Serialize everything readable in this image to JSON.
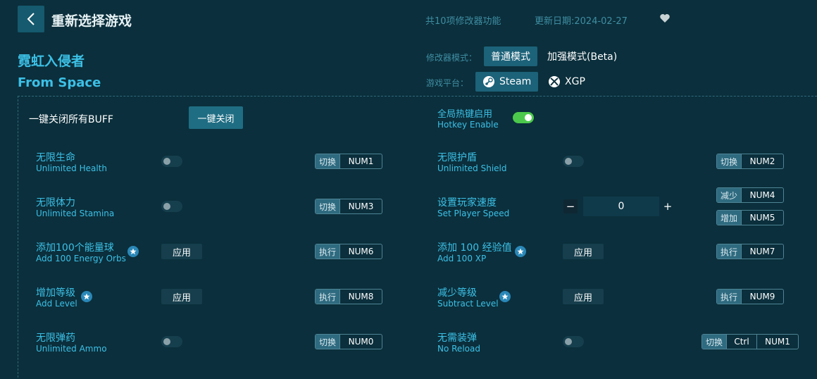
{
  "header": {
    "title": "重新选择游戏",
    "feature_count": "共10项修改器功能",
    "update_date": "更新日期:2024-02-27"
  },
  "game": {
    "title_cn": "霓虹入侵者",
    "title_en": "From Space"
  },
  "mode": {
    "label": "修改器模式：",
    "options": [
      "普通模式",
      "加强模式(Beta)"
    ],
    "selected": "普通模式"
  },
  "platform": {
    "label": "游戏平台：",
    "options": [
      "Steam",
      "XGP"
    ],
    "selected": "Steam"
  },
  "global": {
    "close_all_label": "一键关闭所有BUFF",
    "close_all_button": "一键关闭",
    "hotkey_cn": "全局热键启用",
    "hotkey_en": "Hotkey Enable",
    "hotkey_enabled": true
  },
  "cheats": {
    "unlimited_health": {
      "cn": "无限生命",
      "en": "Unlimited Health",
      "tag": "切换",
      "key": "NUM1",
      "on": false
    },
    "unlimited_shield": {
      "cn": "无限护盾",
      "en": "Unlimited Shield",
      "tag": "切换",
      "key": "NUM2",
      "on": false
    },
    "unlimited_stamina": {
      "cn": "无限体力",
      "en": "Unlimited Stamina",
      "tag": "切换",
      "key": "NUM3",
      "on": false
    },
    "player_speed": {
      "cn": "设置玩家速度",
      "en": "Set Player Speed",
      "value": "0",
      "dec_tag": "减少",
      "dec_key": "NUM4",
      "inc_tag": "增加",
      "inc_key": "NUM5",
      "minus": "−",
      "plus": "+"
    },
    "energy_orbs": {
      "cn": "添加100个能量球",
      "en": "Add 100 Energy Orbs",
      "button": "应用",
      "tag": "执行",
      "key": "NUM6"
    },
    "add_xp": {
      "cn": "添加 100 经验值",
      "en": "Add 100 XP",
      "button": "应用",
      "tag": "执行",
      "key": "NUM7"
    },
    "add_level": {
      "cn": "增加等级",
      "en": "Add Level",
      "button": "应用",
      "tag": "执行",
      "key": "NUM8"
    },
    "subtract_level": {
      "cn": "减少等级",
      "en": "Subtract Level",
      "button": "应用",
      "tag": "执行",
      "key": "NUM9"
    },
    "unlimited_ammo": {
      "cn": "无限弹药",
      "en": "Unlimited Ammo",
      "tag": "切换",
      "key": "NUM0",
      "on": false
    },
    "no_reload": {
      "cn": "无需装弹",
      "en": "No Reload",
      "tag": "切换",
      "key1": "Ctrl",
      "key2": "NUM1",
      "on": false
    }
  },
  "colors": {
    "background": "#0b2f3c",
    "accent": "#3cc0e6",
    "toggle_on": "#4cc94c"
  }
}
